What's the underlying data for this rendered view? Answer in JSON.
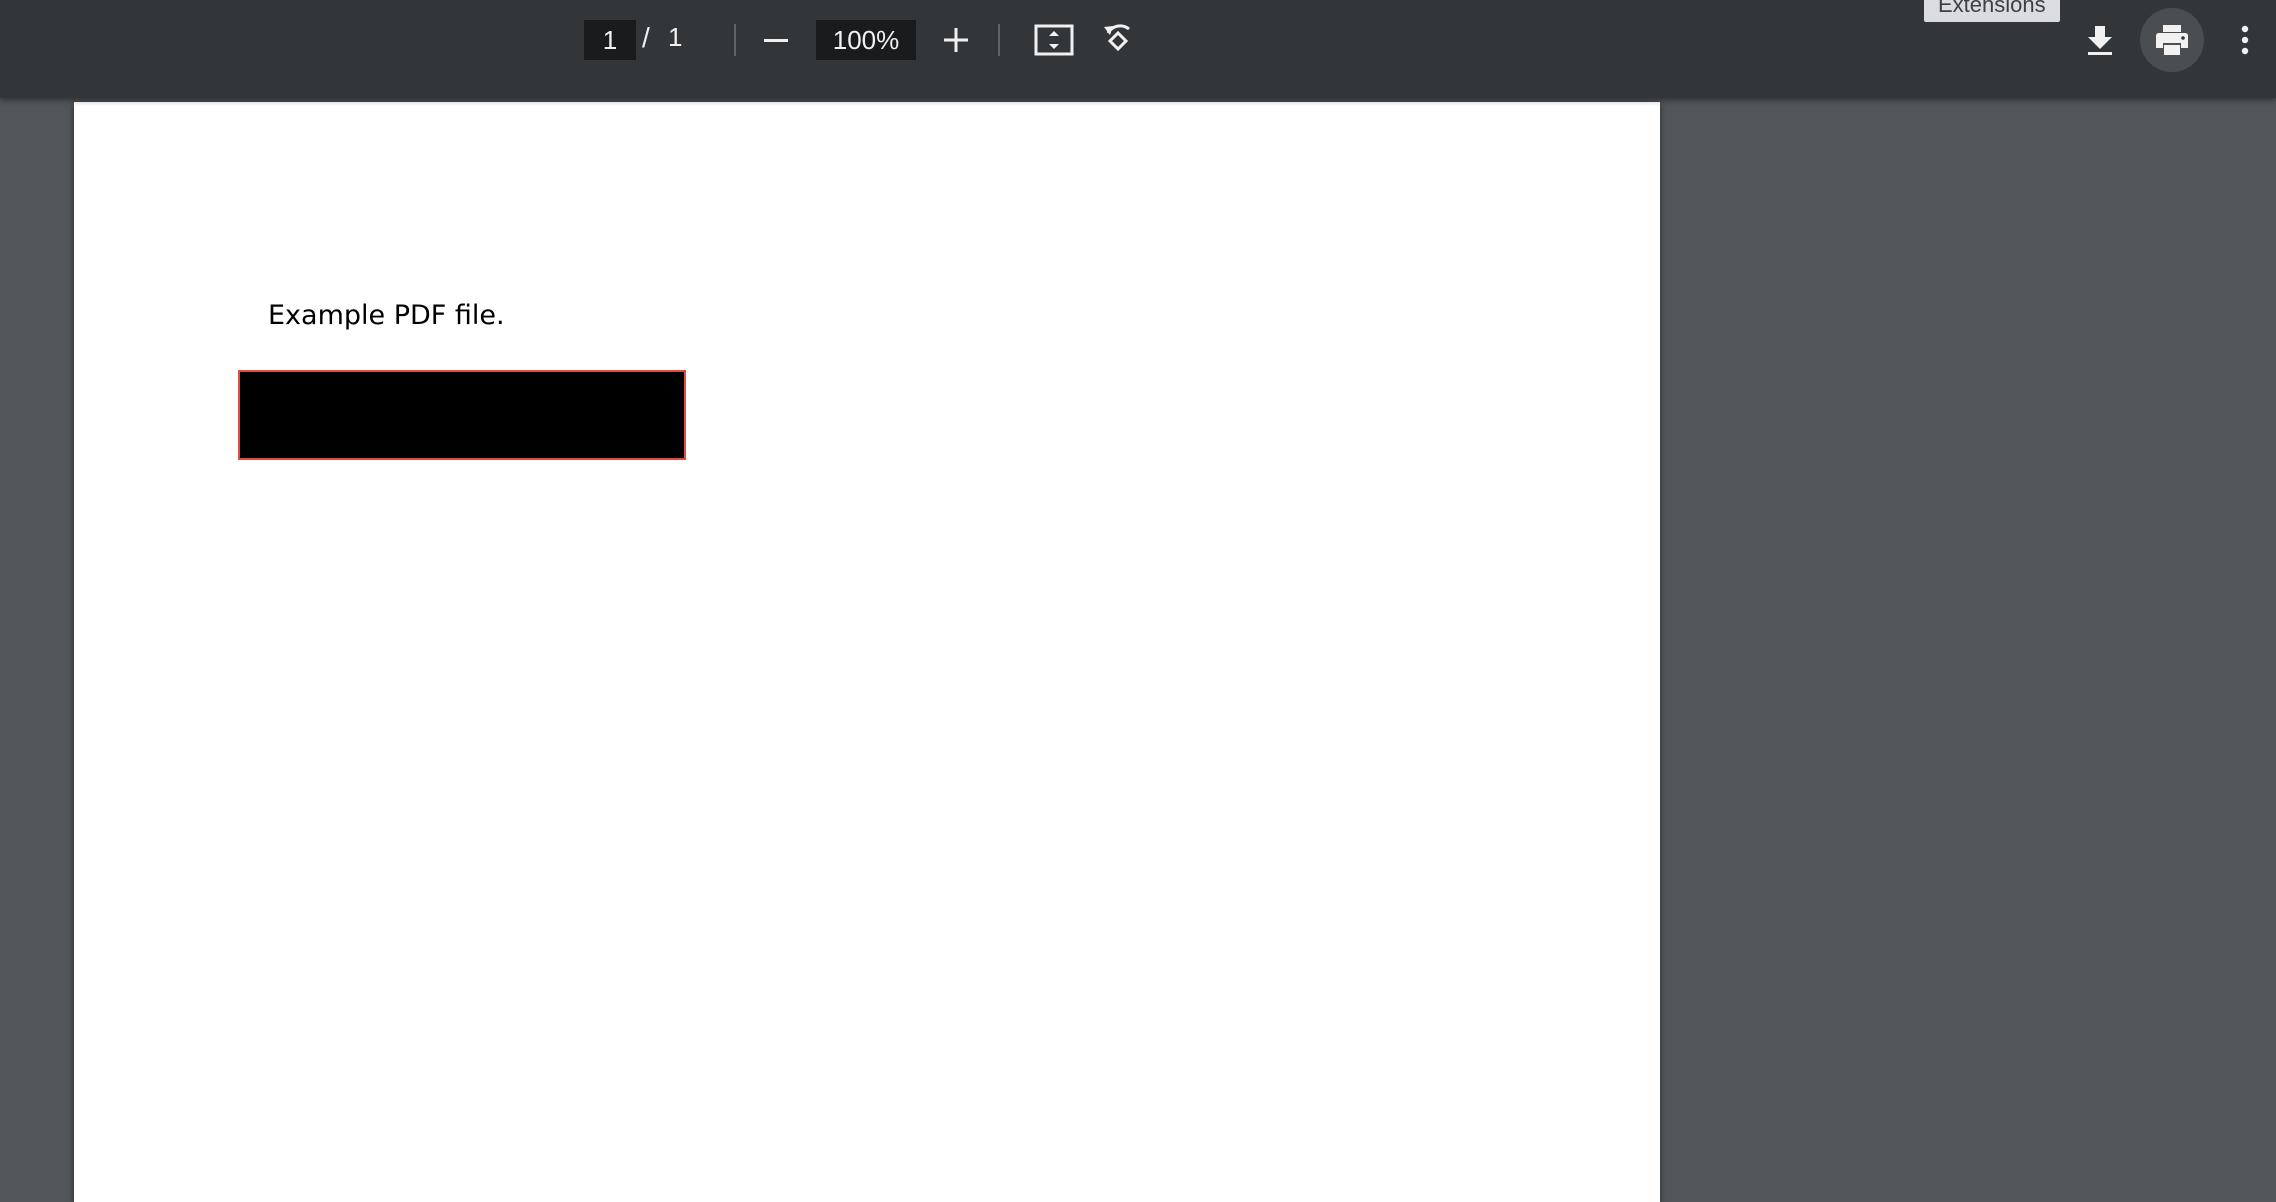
{
  "toolbar": {
    "page_current": "1",
    "page_separator": "/",
    "page_total": "1",
    "zoom_value": "100%",
    "tooltip_text": "Extensions",
    "icons": {
      "zoom_out": "minus-icon",
      "zoom_in": "plus-icon",
      "fit": "fit-to-page-icon",
      "rotate": "rotate-counterclockwise-icon",
      "download": "download-icon",
      "print": "print-icon",
      "more": "more-vertical-icon"
    },
    "colors": {
      "toolbar_bg": "#323639",
      "viewer_bg": "#525659",
      "redaction_border": "#e04b43"
    }
  },
  "document": {
    "text": "Example PDF file."
  }
}
